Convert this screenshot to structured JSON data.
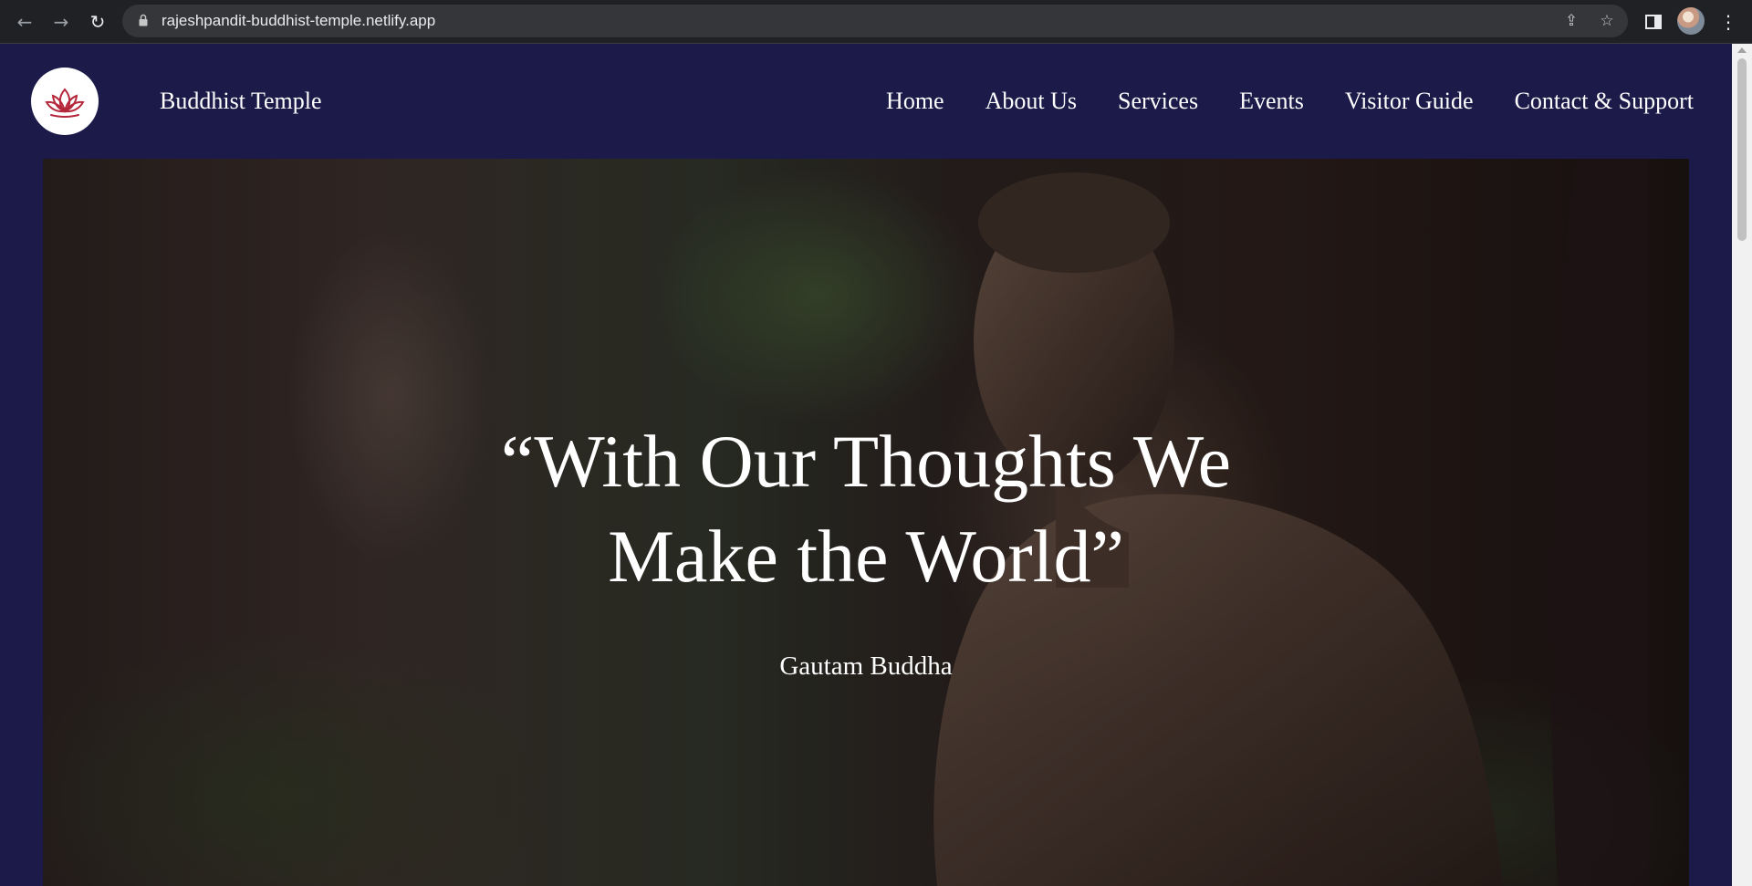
{
  "browser": {
    "url": "rajeshpandit-buddhist-temple.netlify.app",
    "icons": [
      "back-icon",
      "forward-icon",
      "reload-icon",
      "lock-icon",
      "share-icon",
      "star-icon",
      "side-panel-icon",
      "avatar",
      "menu-dots-icon"
    ]
  },
  "header": {
    "logo_icon": "lotus-icon",
    "brand": "Buddhist Temple",
    "nav": [
      {
        "label": "Home"
      },
      {
        "label": "About Us"
      },
      {
        "label": "Services"
      },
      {
        "label": "Events"
      },
      {
        "label": "Visitor Guide"
      },
      {
        "label": "Contact & Support"
      }
    ]
  },
  "hero": {
    "quote_line1": "“With Our Thoughts We",
    "quote_line2": "Make the World”",
    "author": "Gautam Buddha"
  },
  "colors": {
    "header_bg": "#1b1a49",
    "logo_accent": "#b5283c",
    "text": "#ffffff"
  }
}
